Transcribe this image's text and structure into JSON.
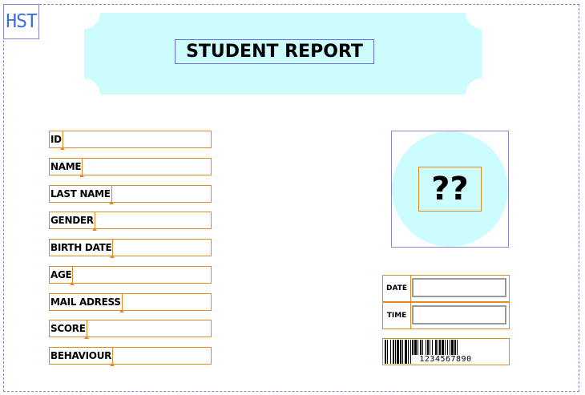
{
  "logo": {
    "text": "HST"
  },
  "header": {
    "title": "STUDENT REPORT",
    "banner_color": "#ccfcfd"
  },
  "fields": [
    {
      "label": "ID"
    },
    {
      "label": "NAME"
    },
    {
      "label": "LAST NAME"
    },
    {
      "label": "GENDER"
    },
    {
      "label": "BIRTH DATE"
    },
    {
      "label": "AGE"
    },
    {
      "label": "MAIL ADRESS"
    },
    {
      "label": "SCORE"
    },
    {
      "label": "BEHAVIOUR"
    }
  ],
  "photo": {
    "placeholder": "??"
  },
  "date_time": {
    "date_label": "DATE",
    "time_label": "TIME"
  },
  "barcode": {
    "number": "1234567890"
  },
  "colors": {
    "field_border": "#e08a1f",
    "frame_border": "#8b84d6",
    "accent_fill": "#ccfcfd"
  }
}
